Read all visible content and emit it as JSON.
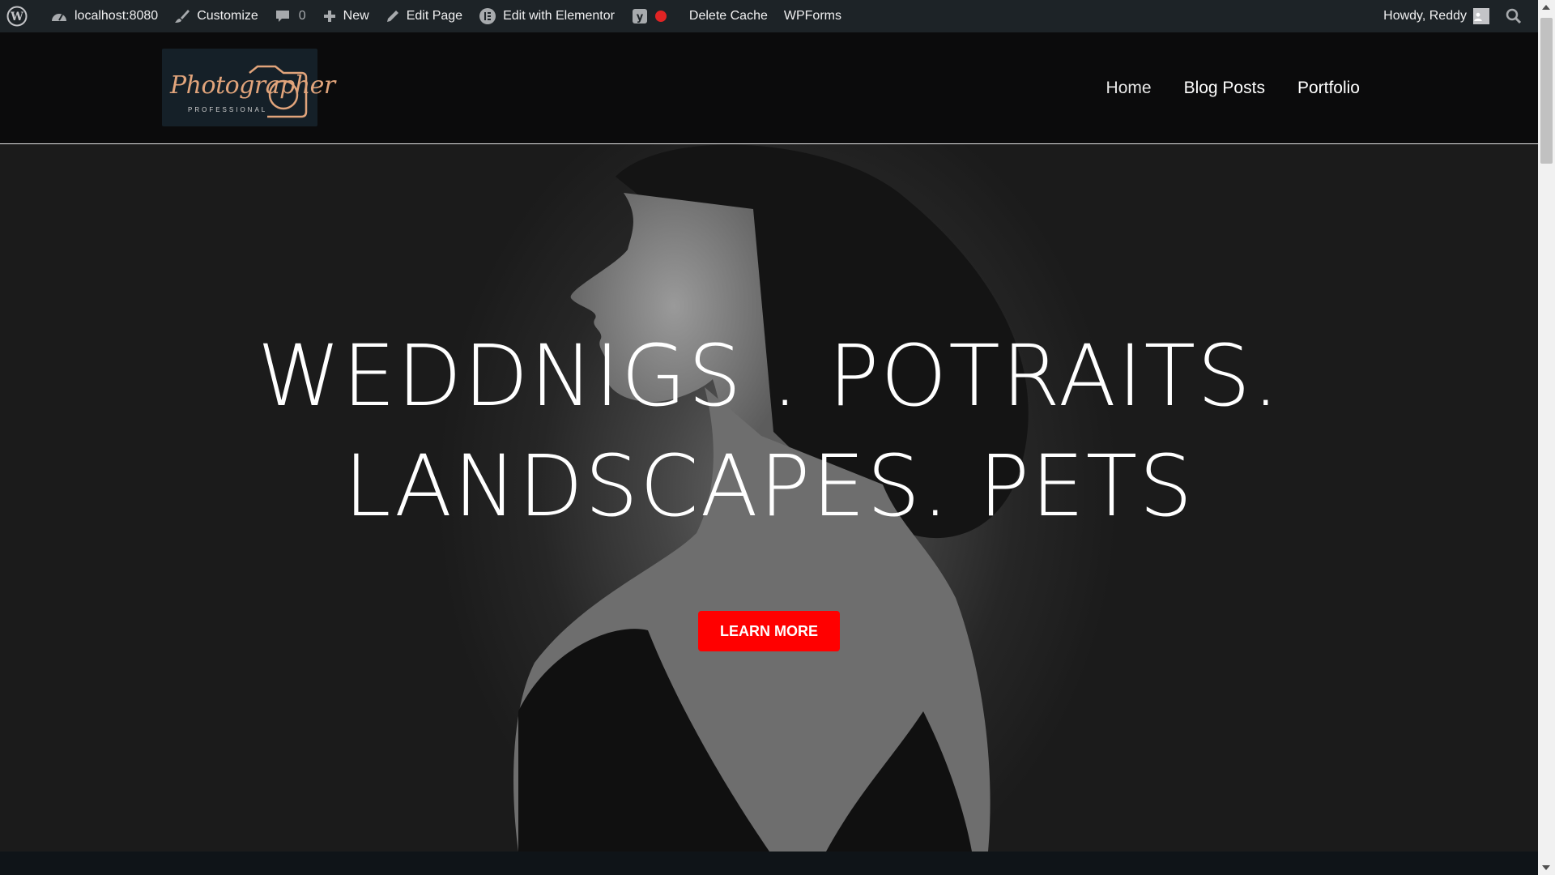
{
  "admin_bar": {
    "site": "localhost:8080",
    "customize": "Customize",
    "comments_count": "0",
    "new": "New",
    "edit_page": "Edit Page",
    "edit_elementor": "Edit with Elementor",
    "delete_cache": "Delete Cache",
    "wpforms": "WPForms",
    "greeting": "Howdy, Reddy",
    "yoast_status_color": "#e02424"
  },
  "site": {
    "logo_text": "Photographer",
    "logo_subtext": "PROFESSIONAL",
    "logo_color": "#e1a47b"
  },
  "nav": {
    "items": [
      "Home",
      "Blog Posts",
      "Portfolio"
    ]
  },
  "hero": {
    "title_line1": "WEDDNIGS . POTRAITS.",
    "title_line2": "LANDSCAPES. PETS",
    "button_label": "LEARN MORE",
    "button_color": "#ff0000"
  }
}
